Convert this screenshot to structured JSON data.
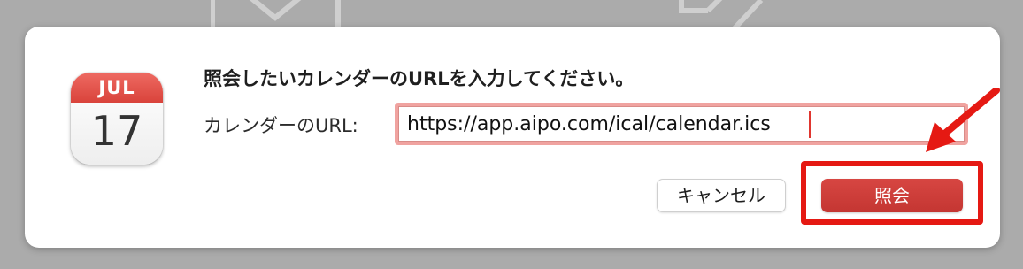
{
  "dialog": {
    "prompt": "照会したいカレンダーのURLを入力してください。",
    "url_label": "カレンダーのURL:",
    "url_value": "https://app.aipo.com/ical/calendar.ics",
    "cancel_label": "キャンセル",
    "ok_label": "照会"
  },
  "calendar_icon": {
    "month": "JUL",
    "day": "17"
  },
  "colors": {
    "accent": "#c43632",
    "annotation": "#e51913"
  },
  "icons": [
    "envelope-icon",
    "edit-icon",
    "calendar-app-icon",
    "annotation-arrow-icon"
  ]
}
